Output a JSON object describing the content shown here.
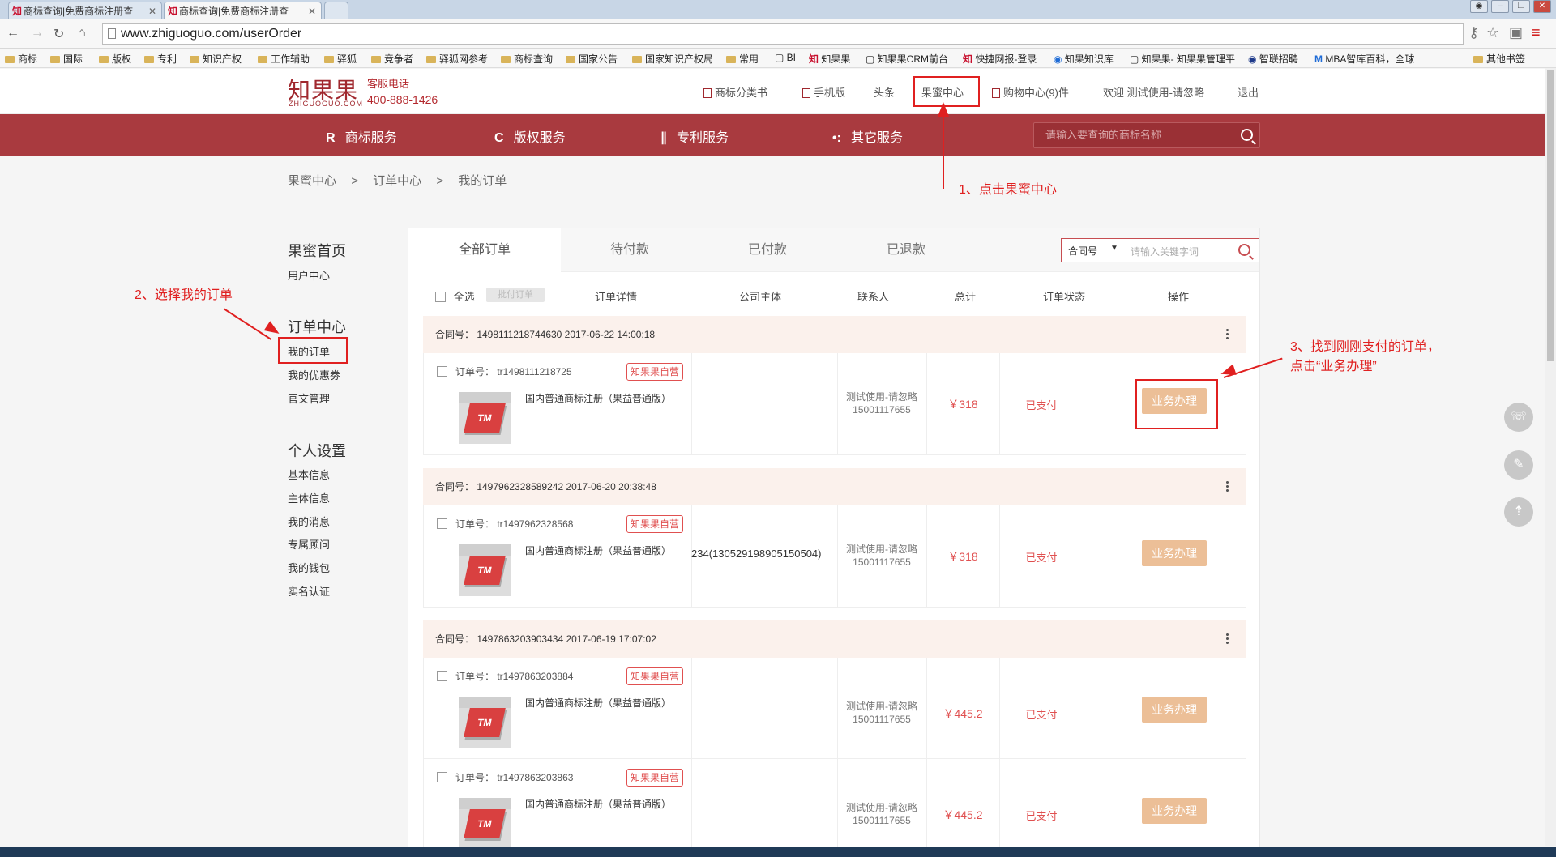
{
  "browser": {
    "tabs": [
      {
        "title": "商标查询|免费商标注册查"
      },
      {
        "title": "商标查询|免费商标注册查"
      }
    ],
    "url": "www.zhiguoguo.com/userOrder",
    "bookmarks": [
      "商标",
      "国际",
      "版权",
      "专利",
      "知识产权",
      "工作辅助",
      "驿狐",
      "竞争者",
      "驿狐网参考",
      "商标查询",
      "国家公告",
      "国家知识产权局",
      "常用",
      "BI",
      "知果果",
      "知果果CRM前台",
      "快捷网报-登录",
      "知果知识库",
      "知果果- 知果果管理平",
      "智联招聘",
      "MBA智库百科，全球",
      "其他书签"
    ]
  },
  "site": {
    "logo": "知果果",
    "logo_sub": "ZHIGUOGUO.COM",
    "hotline_label": "客服电话",
    "hotline": "400-888-1426",
    "topnav": {
      "classify": "商标分类书",
      "mobile": "手机版",
      "headline": "头条",
      "center": "果蜜中心",
      "cart": "购物中心(9)件",
      "welcome": "欢迎 测试使用-请忽略",
      "logout": "退出"
    },
    "mainnav": {
      "trademark": "商标服务",
      "copyright": "版权服务",
      "patent": "专利服务",
      "other": "其它服务",
      "search_placeholder": "请输入要查询的商标名称"
    },
    "breadcrumb": [
      "果蜜中心",
      ">",
      "订单中心",
      ">",
      "我的订单"
    ]
  },
  "sidebar": {
    "home_title": "果蜜首页",
    "user_center": "用户中心",
    "order_title": "订单中心",
    "my_orders": "我的订单",
    "coupons": "我的优惠劵",
    "docs": "官文管理",
    "personal_title": "个人设置",
    "basic": "基本信息",
    "entity": "主体信息",
    "messages": "我的消息",
    "advisor": "专属顾问",
    "wallet": "我的钱包",
    "realname": "实名认证"
  },
  "orders": {
    "tabs": [
      "全部订单",
      "待付款",
      "已付款",
      "已退款"
    ],
    "search_select": "合同号",
    "search_placeholder": "请输入关键字词",
    "columns": {
      "select_all": "全选",
      "batch": "批付订单",
      "detail": "订单详情",
      "company": "公司主体",
      "contact": "联系人",
      "total": "总计",
      "status": "订单状态",
      "op": "操作"
    },
    "groups": [
      {
        "contract": "合同号： 1498111218744630 2017-06-22 14:00:18"
      },
      {
        "contract": "合同号： 1497962328589242 2017-06-20 20:38:48"
      },
      {
        "contract": "合同号： 1497863203903434 2017-06-19 17:07:02"
      }
    ],
    "rows": [
      {
        "order": "订单号： tr1498111218725",
        "badge": "知果果自营",
        "product": "国内普通商标注册（果益普通版）",
        "company": "",
        "contact1": "测试使用-请忽略",
        "contact2": "15001117655",
        "total": "￥318",
        "status": "已支付",
        "action": "业务办理"
      },
      {
        "order": "订单号： tr1497962328568",
        "badge": "知果果自营",
        "product": "国内普通商标注册（果益普通版）",
        "company": "234(130529198905150504)",
        "contact1": "测试使用-请忽略",
        "contact2": "15001117655",
        "total": "￥318",
        "status": "已支付",
        "action": "业务办理"
      },
      {
        "order": "订单号： tr1497863203884",
        "badge": "知果果自营",
        "product": "国内普通商标注册（果益普通版）",
        "company": "",
        "contact1": "测试使用-请忽略",
        "contact2": "15001117655",
        "total": "￥445.2",
        "status": "已支付",
        "action": "业务办理"
      },
      {
        "order": "订单号： tr1497863203863",
        "badge": "知果果自营",
        "product": "国内普通商标注册（果益普通版）",
        "company": "",
        "contact1": "测试使用-请忽略",
        "contact2": "15001117655",
        "total": "￥445.2",
        "status": "已支付",
        "action": "业务办理"
      }
    ],
    "thumb_text": "TM"
  },
  "annotations": {
    "step1": "1、点击果蜜中心",
    "step2": "2、选择我的订单",
    "step3_line1": "3、找到刚刚支付的订单，",
    "step3_line2": "点击“业务办理”"
  }
}
